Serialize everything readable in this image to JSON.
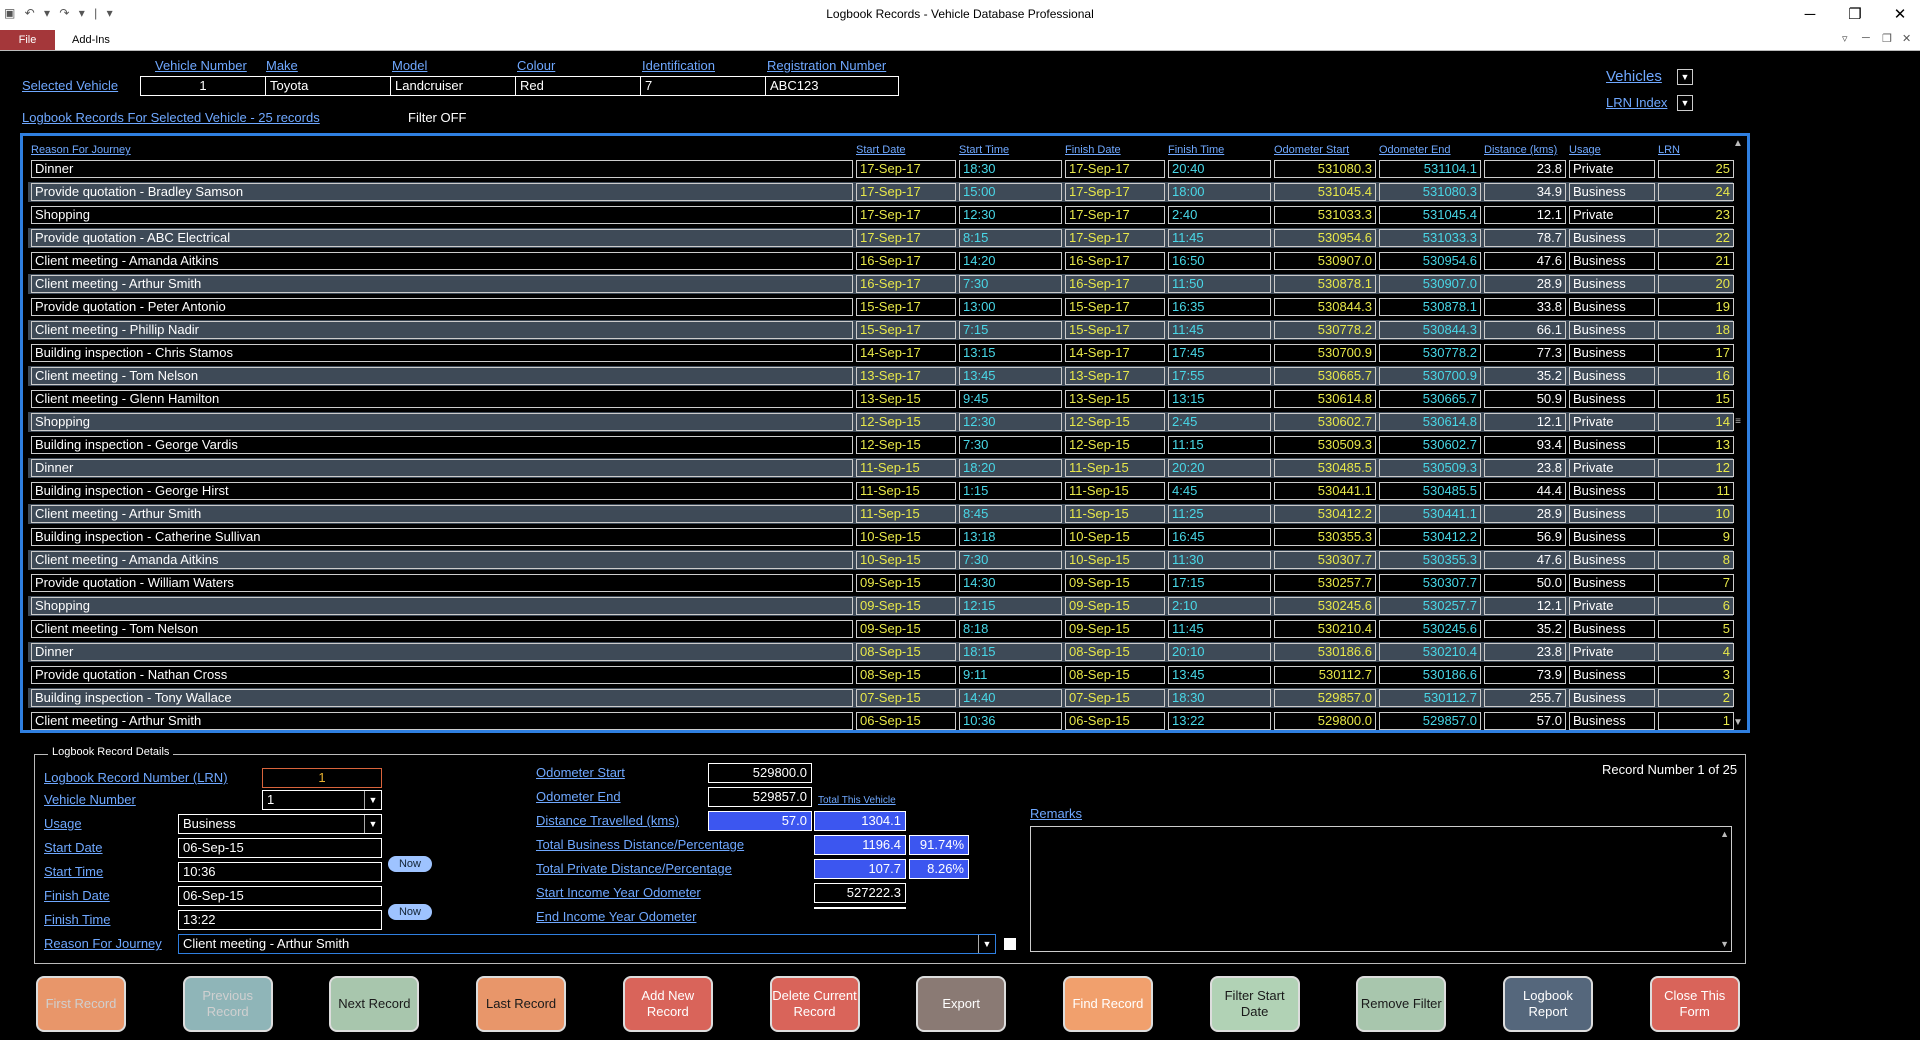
{
  "window": {
    "title": "Logbook Records  -  Vehicle Database Professional",
    "tabs": [
      "File",
      "Add-Ins"
    ]
  },
  "vehicle": {
    "selected_label": "Selected Vehicle",
    "headers": [
      "Vehicle Number",
      "Make",
      "Model",
      "Colour",
      "Identification",
      "Registration Number"
    ],
    "values": [
      "1",
      "Toyota",
      "Landcruiser",
      "Red",
      "7",
      "ABC123"
    ],
    "vehicles_link": "Vehicles",
    "lrn_index_link": "LRN Index"
  },
  "records": {
    "title": "Logbook Records For Selected Vehicle - 25 records",
    "filter_status": "Filter OFF",
    "columns": [
      "Reason For Journey",
      "Start Date",
      "Start Time",
      "Finish Date",
      "Finish Time",
      "Odometer Start",
      "Odometer End",
      "Distance (kms)",
      "Usage",
      "LRN"
    ],
    "rows": [
      [
        "Dinner",
        "17-Sep-17",
        "18:30",
        "17-Sep-17",
        "20:40",
        "531080.3",
        "531104.1",
        "23.8",
        "Private",
        "25"
      ],
      [
        "Provide quotation - Bradley Samson",
        "17-Sep-17",
        "15:00",
        "17-Sep-17",
        "18:00",
        "531045.4",
        "531080.3",
        "34.9",
        "Business",
        "24"
      ],
      [
        "Shopping",
        "17-Sep-17",
        "12:30",
        "17-Sep-17",
        "2:40",
        "531033.3",
        "531045.4",
        "12.1",
        "Private",
        "23"
      ],
      [
        "Provide quotation - ABC Electrical",
        "17-Sep-17",
        "8:15",
        "17-Sep-17",
        "11:45",
        "530954.6",
        "531033.3",
        "78.7",
        "Business",
        "22"
      ],
      [
        "Client meeting - Amanda Aitkins",
        "16-Sep-17",
        "14:20",
        "16-Sep-17",
        "16:50",
        "530907.0",
        "530954.6",
        "47.6",
        "Business",
        "21"
      ],
      [
        "Client meeting - Arthur Smith",
        "16-Sep-17",
        "7:30",
        "16-Sep-17",
        "11:50",
        "530878.1",
        "530907.0",
        "28.9",
        "Business",
        "20"
      ],
      [
        "Provide quotation - Peter Antonio",
        "15-Sep-17",
        "13:00",
        "15-Sep-17",
        "16:35",
        "530844.3",
        "530878.1",
        "33.8",
        "Business",
        "19"
      ],
      [
        "Client meeting - Phillip Nadir",
        "15-Sep-17",
        "7:15",
        "15-Sep-17",
        "11:45",
        "530778.2",
        "530844.3",
        "66.1",
        "Business",
        "18"
      ],
      [
        "Building inspection - Chris Stamos",
        "14-Sep-17",
        "13:15",
        "14-Sep-17",
        "17:45",
        "530700.9",
        "530778.2",
        "77.3",
        "Business",
        "17"
      ],
      [
        "Client meeting - Tom Nelson",
        "13-Sep-17",
        "13:45",
        "13-Sep-17",
        "17:55",
        "530665.7",
        "530700.9",
        "35.2",
        "Business",
        "16"
      ],
      [
        "Client meeting - Glenn Hamilton",
        "13-Sep-15",
        "9:45",
        "13-Sep-15",
        "13:15",
        "530614.8",
        "530665.7",
        "50.9",
        "Business",
        "15"
      ],
      [
        "Shopping",
        "12-Sep-15",
        "12:30",
        "12-Sep-15",
        "2:45",
        "530602.7",
        "530614.8",
        "12.1",
        "Private",
        "14"
      ],
      [
        "Building inspection - George Vardis",
        "12-Sep-15",
        "7:30",
        "12-Sep-15",
        "11:15",
        "530509.3",
        "530602.7",
        "93.4",
        "Business",
        "13"
      ],
      [
        "Dinner",
        "11-Sep-15",
        "18:20",
        "11-Sep-15",
        "20:20",
        "530485.5",
        "530509.3",
        "23.8",
        "Private",
        "12"
      ],
      [
        "Building inspection - George Hirst",
        "11-Sep-15",
        "1:15",
        "11-Sep-15",
        "4:45",
        "530441.1",
        "530485.5",
        "44.4",
        "Business",
        "11"
      ],
      [
        "Client meeting - Arthur Smith",
        "11-Sep-15",
        "8:45",
        "11-Sep-15",
        "11:25",
        "530412.2",
        "530441.1",
        "28.9",
        "Business",
        "10"
      ],
      [
        "Building inspection - Catherine Sullivan",
        "10-Sep-15",
        "13:18",
        "10-Sep-15",
        "16:45",
        "530355.3",
        "530412.2",
        "56.9",
        "Business",
        "9"
      ],
      [
        "Client meeting - Amanda Aitkins",
        "10-Sep-15",
        "7:30",
        "10-Sep-15",
        "11:30",
        "530307.7",
        "530355.3",
        "47.6",
        "Business",
        "8"
      ],
      [
        "Provide quotation - William Waters",
        "09-Sep-15",
        "14:30",
        "09-Sep-15",
        "17:15",
        "530257.7",
        "530307.7",
        "50.0",
        "Business",
        "7"
      ],
      [
        "Shopping",
        "09-Sep-15",
        "12:15",
        "09-Sep-15",
        "2:10",
        "530245.6",
        "530257.7",
        "12.1",
        "Private",
        "6"
      ],
      [
        "Client meeting - Tom Nelson",
        "09-Sep-15",
        "8:18",
        "09-Sep-15",
        "11:45",
        "530210.4",
        "530245.6",
        "35.2",
        "Business",
        "5"
      ],
      [
        "Dinner",
        "08-Sep-15",
        "18:15",
        "08-Sep-15",
        "20:10",
        "530186.6",
        "530210.4",
        "23.8",
        "Private",
        "4"
      ],
      [
        "Provide quotation - Nathan Cross",
        "08-Sep-15",
        "9:11",
        "08-Sep-15",
        "13:45",
        "530112.7",
        "530186.6",
        "73.9",
        "Business",
        "3"
      ],
      [
        "Building inspection - Tony Wallace",
        "07-Sep-15",
        "14:40",
        "07-Sep-15",
        "18:30",
        "529857.0",
        "530112.7",
        "255.7",
        "Business",
        "2"
      ],
      [
        "Client meeting - Arthur Smith",
        "06-Sep-15",
        "10:36",
        "06-Sep-15",
        "13:22",
        "529800.0",
        "529857.0",
        "57.0",
        "Business",
        "1"
      ]
    ]
  },
  "details": {
    "legend": "Logbook Record Details",
    "lrn_label": "Logbook Record Number (LRN)",
    "lrn_value": "1",
    "vehicle_number_label": "Vehicle Number",
    "vehicle_number_value": "1",
    "usage_label": "Usage",
    "usage_value": "Business",
    "start_date_label": "Start Date",
    "start_date_value": "06-Sep-15",
    "start_time_label": "Start Time",
    "start_time_value": "10:36",
    "finish_date_label": "Finish Date",
    "finish_date_value": "06-Sep-15",
    "finish_time_label": "Finish Time",
    "finish_time_value": "13:22",
    "reason_label": "Reason For Journey",
    "reason_value": "Client meeting - Arthur Smith",
    "now_label": "Now",
    "odo_start_label": "Odometer Start",
    "odo_start_value": "529800.0",
    "odo_end_label": "Odometer End",
    "odo_end_value": "529857.0",
    "total_vehicle_label": "Total This Vehicle",
    "distance_label": "Distance Travelled (kms)",
    "distance_value": "57.0",
    "distance_total": "1304.1",
    "business_label": "Total Business Distance/Percentage",
    "business_value": "1196.4",
    "business_pct": "91.74%",
    "private_label": "Total Private Distance/Percentage",
    "private_value": "107.7",
    "private_pct": "8.26%",
    "income_start_label": "Start Income Year Odometer",
    "income_start_value": "527222.3",
    "income_end_label": "End Income Year Odometer",
    "income_end_value": "",
    "record_counter": "Record Number 1 of 25",
    "remarks_label": "Remarks"
  },
  "buttons": [
    {
      "label": "First Record",
      "color": "#e8966a",
      "text": "#d0d0d0"
    },
    {
      "label": "Previous Record",
      "color": "#8fb5b8",
      "text": "#d0d0d0"
    },
    {
      "label": "Next Record",
      "color": "#a8c6ad",
      "text": "#1a1a1a"
    },
    {
      "label": "Last Record",
      "color": "#e8966a",
      "text": "#1a1a1a"
    },
    {
      "label": "Add New Record",
      "color": "#d9645a",
      "text": "#ffffff"
    },
    {
      "label": "Delete Current Record",
      "color": "#d9645a",
      "text": "#ffffff"
    },
    {
      "label": "Export",
      "color": "#8a7a74",
      "text": "#ffffff"
    },
    {
      "label": "Find Record",
      "color": "#f1a06d",
      "text": "#ffffff"
    },
    {
      "label": "Filter Start Date",
      "color": "#b1d2b5",
      "text": "#1a1a1a"
    },
    {
      "label": "Remove Filter",
      "color": "#a8c6ad",
      "text": "#1a1a1a"
    },
    {
      "label": "Logbook Report",
      "color": "#55677c",
      "text": "#ffffff"
    },
    {
      "label": "Close This Form",
      "color": "#d9645a",
      "text": "#ffffff"
    }
  ]
}
